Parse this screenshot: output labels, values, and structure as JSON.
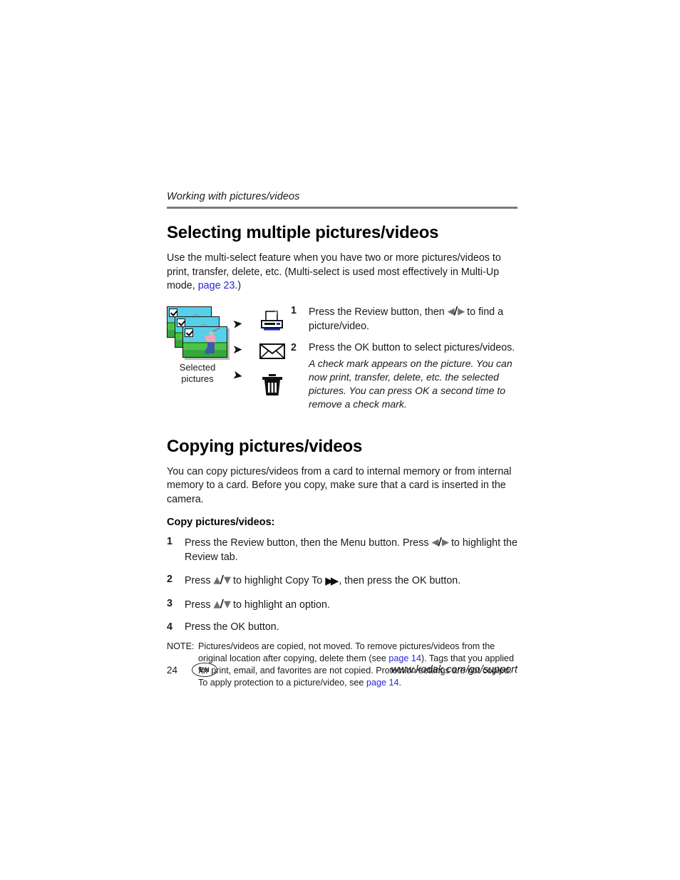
{
  "running_header": "Working with pictures/videos",
  "section1": {
    "title": "Selecting multiple pictures/videos",
    "intro_part1": "Use the multi-select feature when you have two or more pictures/videos to print, transfer, delete, etc. (Multi-select is used most effectively in Multi-Up mode, ",
    "intro_link": "page 23",
    "intro_part2": ".)",
    "figure": {
      "caption_line1": "Selected",
      "caption_line2": "pictures",
      "destinations": [
        "printer-icon",
        "envelope-icon",
        "trash-icon"
      ],
      "arrows": [
        "arrow-right",
        "arrow-right",
        "arrow-right"
      ]
    },
    "steps": [
      {
        "num": "1",
        "text_before": "Press the Review button, then ",
        "glyph": "left-right-arrows",
        "text_after": " to find a picture/video."
      },
      {
        "num": "2",
        "text_before": "Press the OK button to select pictures/videos.",
        "glyph": "",
        "text_after": "",
        "italic_note": "A check mark appears on the picture. You can now print, transfer, delete, etc. the selected pictures. You can press OK a second time to remove a check mark."
      }
    ]
  },
  "section2": {
    "title": "Copying pictures/videos",
    "intro": "You can copy pictures/videos from a card to internal memory or from internal memory to a card. Before you copy, make sure that a card is inserted in the camera.",
    "subhead": "Copy pictures/videos:",
    "steps": [
      {
        "num": "1",
        "part1": "Press the Review button, then the Menu button. Press ",
        "glyph1": "left-right-arrows",
        "part2": " to highlight the Review tab.",
        "glyph2": "",
        "part3": ""
      },
      {
        "num": "2",
        "part1": "Press ",
        "glyph1": "up-down-arrows",
        "part2": " to highlight Copy To ",
        "glyph2": "double-right-arrow",
        "part3": " , then press the OK button."
      },
      {
        "num": "3",
        "part1": "Press ",
        "glyph1": "up-down-arrows",
        "part2": " to highlight an option.",
        "glyph2": "",
        "part3": ""
      },
      {
        "num": "4",
        "part1": "Press the OK button.",
        "glyph1": "",
        "part2": "",
        "glyph2": "",
        "part3": ""
      }
    ],
    "note": {
      "label": "NOTE:",
      "part1": "Pictures/videos are copied, not moved. To remove pictures/videos from the original location after copying, delete them (see ",
      "link1": "page 14",
      "part2": "). Tags that you applied for print, email, and favorites are not copied. Protection settings are not copied. To apply protection to a picture/video, see ",
      "link2": "page 14",
      "part3": "."
    }
  },
  "footer": {
    "page_number": "24",
    "language_badge": "EN",
    "support_url": "www.kodak.com/go/support"
  },
  "colors": {
    "link": "#2726d8",
    "rule": "#7a7a7a",
    "text": "#1a1a1a"
  }
}
